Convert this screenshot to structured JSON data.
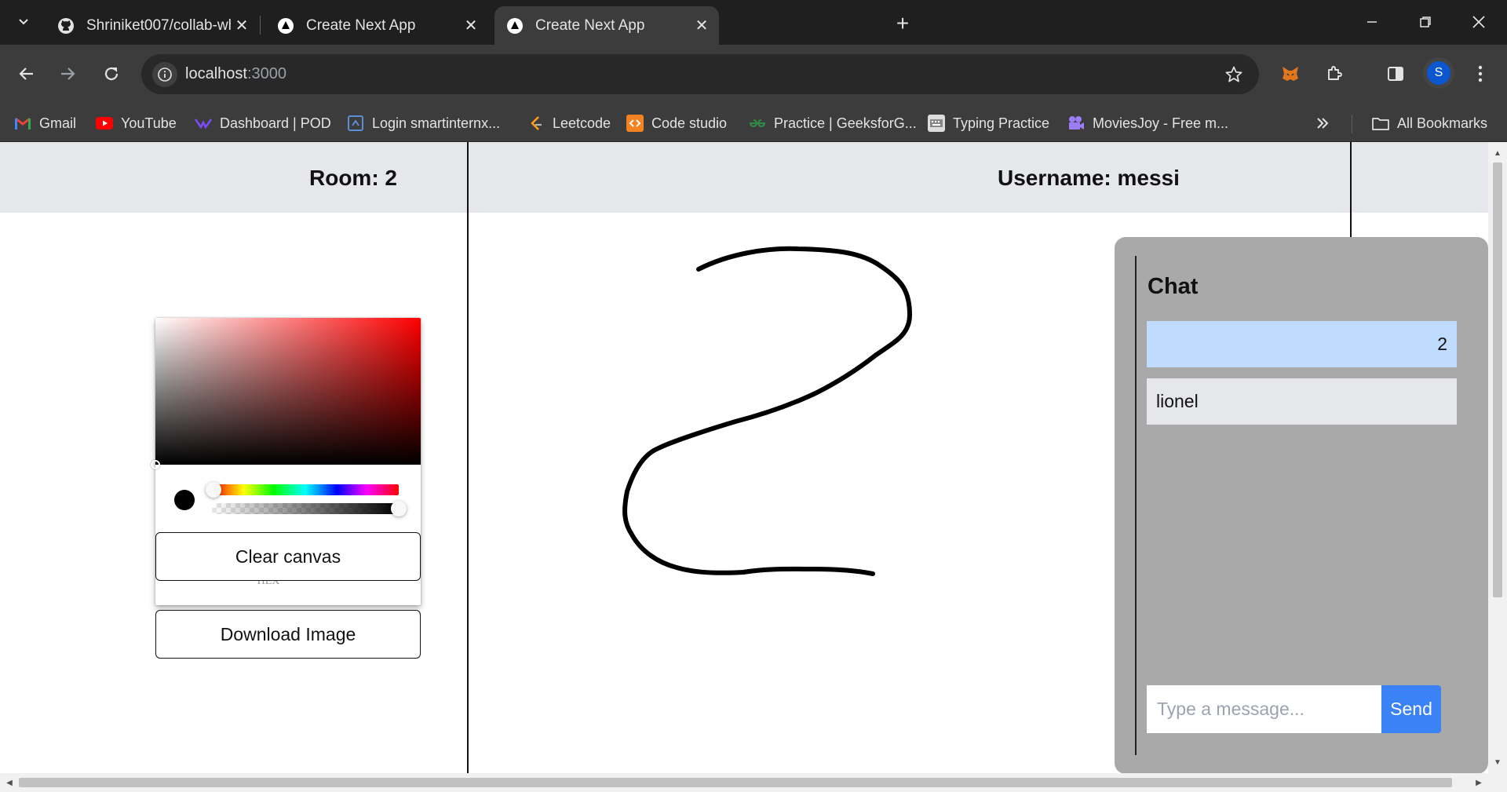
{
  "browser": {
    "tabs": [
      {
        "title": "Shriniket007/collab-whiteboard",
        "icon": "github-icon",
        "active": false
      },
      {
        "title": "Create Next App",
        "icon": "nextjs-icon",
        "active": false
      },
      {
        "title": "Create Next App",
        "icon": "nextjs-icon",
        "active": true
      }
    ],
    "url_host": "localhost",
    "url_port": ":3000",
    "profile_initial": "S",
    "bookmarks": [
      {
        "label": "Gmail",
        "icon": "gmail-icon"
      },
      {
        "label": "YouTube",
        "icon": "youtube-icon"
      },
      {
        "label": "Dashboard | POD",
        "icon": "pod-icon"
      },
      {
        "label": "Login smartinternx...",
        "icon": "smartinternz-icon"
      },
      {
        "label": "Leetcode",
        "icon": "leetcode-icon"
      },
      {
        "label": "Code studio",
        "icon": "codestudio-icon"
      },
      {
        "label": "Practice | GeeksforG...",
        "icon": "gfg-icon"
      },
      {
        "label": "Typing Practice",
        "icon": "typing-icon"
      },
      {
        "label": "MoviesJoy - Free m...",
        "icon": "moviesjoy-icon"
      }
    ],
    "all_bookmarks_label": "All Bookmarks"
  },
  "page": {
    "room_label": "Room: 2",
    "username_label": "Username: messi",
    "color_picker": {
      "hex_value": "#000000",
      "mode_label": "HEX",
      "selected_color": "#000000"
    },
    "clear_button": "Clear canvas",
    "download_button": "Download Image",
    "chat": {
      "title": "Chat",
      "messages": [
        {
          "text": "2",
          "own": true
        },
        {
          "text": "lionel",
          "own": false
        }
      ],
      "input_placeholder": "Type a message...",
      "send_label": "Send"
    }
  },
  "colors": {
    "header_bg": "#e5e7eb",
    "chat_bg": "#a9a9a9",
    "own_message_bg": "#bfdbfe",
    "other_message_bg": "#e5e7eb",
    "send_button_bg": "#3b82f6",
    "stroke": "#000000"
  }
}
